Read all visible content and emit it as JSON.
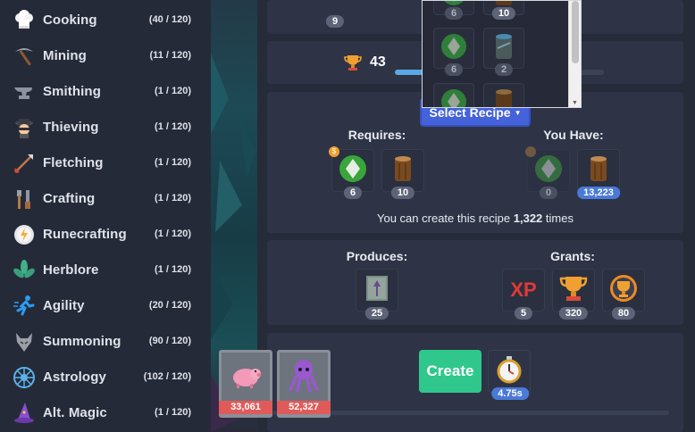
{
  "sidebar": {
    "skills": [
      {
        "name": "Cooking",
        "level": "(40 / 120)",
        "icon": "chef-hat-icon"
      },
      {
        "name": "Mining",
        "level": "(11 / 120)",
        "icon": "pickaxe-icon"
      },
      {
        "name": "Smithing",
        "level": "(1 / 120)",
        "icon": "anvil-icon"
      },
      {
        "name": "Thieving",
        "level": "(1 / 120)",
        "icon": "thief-icon"
      },
      {
        "name": "Fletching",
        "level": "(1 / 120)",
        "icon": "arrow-icon"
      },
      {
        "name": "Crafting",
        "level": "(1 / 120)",
        "icon": "tools-icon"
      },
      {
        "name": "Runecrafting",
        "level": "(1 / 120)",
        "icon": "rune-icon"
      },
      {
        "name": "Herblore",
        "level": "(1 / 120)",
        "icon": "herb-leaf-icon"
      },
      {
        "name": "Agility",
        "level": "(20 / 120)",
        "icon": "running-man-icon"
      },
      {
        "name": "Summoning",
        "level": "(90 / 120)",
        "icon": "wolf-icon"
      },
      {
        "name": "Astrology",
        "level": "(102 / 120)",
        "icon": "star-wheel-icon"
      },
      {
        "name": "Alt. Magic",
        "level": "(1 / 120)",
        "icon": "wizard-hat-icon"
      }
    ]
  },
  "top_panel": {
    "count": "9"
  },
  "mastery": {
    "value": "43",
    "progress_fraction": 0.7,
    "icon": "trophy-icon"
  },
  "dropdown": {
    "items": [
      {
        "count": "6",
        "icon": "green-gem-icon"
      },
      {
        "count": "10",
        "icon": "log-icon"
      },
      {
        "count": "6",
        "icon": "green-gem-icon"
      },
      {
        "count": "2",
        "icon": "blue-log-icon"
      }
    ]
  },
  "recipe": {
    "select_label": "Select Recipe",
    "requires_label": "Requires:",
    "you_have_label": "You Have:",
    "requires": [
      {
        "count": "6",
        "icon": "green-gem-icon"
      },
      {
        "count": "10",
        "icon": "log-icon"
      }
    ],
    "have": [
      {
        "count": "0",
        "icon": "green-gem-icon"
      },
      {
        "count": "13,223",
        "icon": "log-icon"
      }
    ],
    "create_prefix": "You can create this recipe",
    "create_count": "1,322",
    "create_suffix": "times"
  },
  "produces": {
    "produces_label": "Produces:",
    "grants_label": "Grants:",
    "product": {
      "count": "25",
      "icon": "tree-tablet-icon"
    },
    "grants": [
      {
        "count": "5",
        "label": "XP",
        "icon": "xp-icon"
      },
      {
        "count": "320",
        "icon": "trophy-icon"
      },
      {
        "count": "80",
        "icon": "pool-trophy-icon"
      }
    ]
  },
  "action": {
    "create_label": "Create",
    "time": "4.75s",
    "time_icon": "stopwatch-icon"
  },
  "bank": [
    {
      "count": "33,061",
      "icon": "pig-familiar-icon"
    },
    {
      "count": "52,327",
      "icon": "octopus-familiar-icon"
    }
  ],
  "colors": {
    "accent_blue": "#4462d9",
    "create_green": "#30c78d",
    "count_red": "#e05a5a"
  }
}
